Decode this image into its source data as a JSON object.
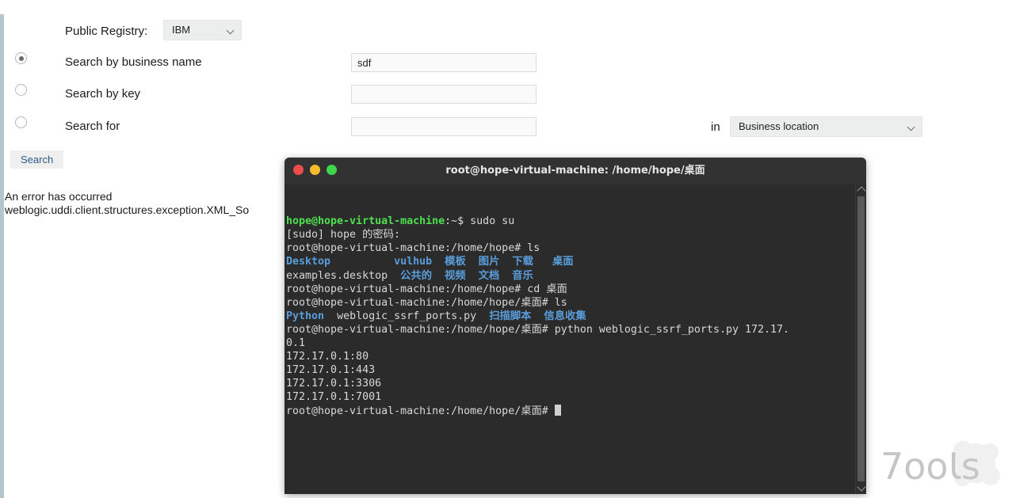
{
  "form": {
    "registry_label": "Public Registry:",
    "registry_value": "IBM",
    "rows": [
      {
        "label": "Search by business name",
        "value": "sdf",
        "placeholder": "",
        "selected": true
      },
      {
        "label": "Search by key",
        "value": "",
        "placeholder": "",
        "selected": false
      },
      {
        "label": "Search for",
        "value": "",
        "placeholder": "",
        "selected": false
      }
    ],
    "in_label": "in",
    "location_value": "Business location",
    "search_button": "Search"
  },
  "error": {
    "title": "An error has occurred",
    "detail": "weblogic.uddi.client.structures.exception.XML_So"
  },
  "terminal": {
    "title": "root@hope-virtual-machine: /home/hope/桌面",
    "lines": [
      {
        "segments": [
          {
            "text": "hope@hope-virtual-machine",
            "color": "green"
          },
          {
            "text": ":~$ ",
            "color": "white"
          },
          {
            "text": "sudo su",
            "color": "plain"
          }
        ]
      },
      {
        "segments": [
          {
            "text": "[sudo] hope 的密码:",
            "color": "plain"
          }
        ]
      },
      {
        "segments": [
          {
            "text": "root@hope-virtual-machine:/home/hope# ls",
            "color": "plain"
          }
        ]
      },
      {
        "segments": [
          {
            "text": "Desktop",
            "color": "blue"
          },
          {
            "text": "          ",
            "color": "plain"
          },
          {
            "text": "vulhub",
            "color": "blue"
          },
          {
            "text": "  ",
            "color": "plain"
          },
          {
            "text": "模板",
            "color": "blue"
          },
          {
            "text": "  ",
            "color": "plain"
          },
          {
            "text": "图片",
            "color": "blue"
          },
          {
            "text": "  ",
            "color": "plain"
          },
          {
            "text": "下载",
            "color": "blue"
          },
          {
            "text": "   ",
            "color": "plain"
          },
          {
            "text": "桌面",
            "color": "blue"
          }
        ]
      },
      {
        "segments": [
          {
            "text": "examples.desktop",
            "color": "plain"
          },
          {
            "text": "  ",
            "color": "plain"
          },
          {
            "text": "公共的",
            "color": "blue"
          },
          {
            "text": "  ",
            "color": "plain"
          },
          {
            "text": "视频",
            "color": "blue"
          },
          {
            "text": "  ",
            "color": "plain"
          },
          {
            "text": "文档",
            "color": "blue"
          },
          {
            "text": "  ",
            "color": "plain"
          },
          {
            "text": "音乐",
            "color": "blue"
          }
        ]
      },
      {
        "segments": [
          {
            "text": "root@hope-virtual-machine:/home/hope# cd 桌面",
            "color": "plain"
          }
        ]
      },
      {
        "segments": [
          {
            "text": "root@hope-virtual-machine:/home/hope/桌面# ls",
            "color": "plain"
          }
        ]
      },
      {
        "segments": [
          {
            "text": "Python",
            "color": "blue"
          },
          {
            "text": "  ",
            "color": "plain"
          },
          {
            "text": "weblogic_ssrf_ports.py",
            "color": "plain"
          },
          {
            "text": "  ",
            "color": "plain"
          },
          {
            "text": "扫描脚本",
            "color": "blue"
          },
          {
            "text": "  ",
            "color": "plain"
          },
          {
            "text": "信息收集",
            "color": "blue"
          }
        ]
      },
      {
        "segments": [
          {
            "text": "root@hope-virtual-machine:/home/hope/桌面# python weblogic_ssrf_ports.py 172.17.",
            "color": "plain"
          }
        ]
      },
      {
        "segments": [
          {
            "text": "0.1",
            "color": "plain"
          }
        ]
      },
      {
        "segments": [
          {
            "text": "172.17.0.1:80",
            "color": "plain"
          }
        ]
      },
      {
        "segments": [
          {
            "text": "172.17.0.1:443",
            "color": "plain"
          }
        ]
      },
      {
        "segments": [
          {
            "text": "172.17.0.1:3306",
            "color": "plain"
          }
        ]
      },
      {
        "segments": [
          {
            "text": "172.17.0.1:7001",
            "color": "plain"
          }
        ]
      },
      {
        "segments": [
          {
            "text": "root@hope-virtual-machine:/home/hope/桌面# ",
            "color": "plain"
          },
          {
            "text": "",
            "cursor": true
          }
        ]
      }
    ]
  },
  "watermark": {
    "text": "7ools"
  },
  "colors": {
    "terminal_bg": "#2b2b2b",
    "terminal_titlebar": "#323232",
    "prompt_green": "#4ee04e",
    "dir_blue": "#5a9ddb",
    "accent_strip": "#b3c6cb",
    "button_text": "#2a5a88"
  }
}
